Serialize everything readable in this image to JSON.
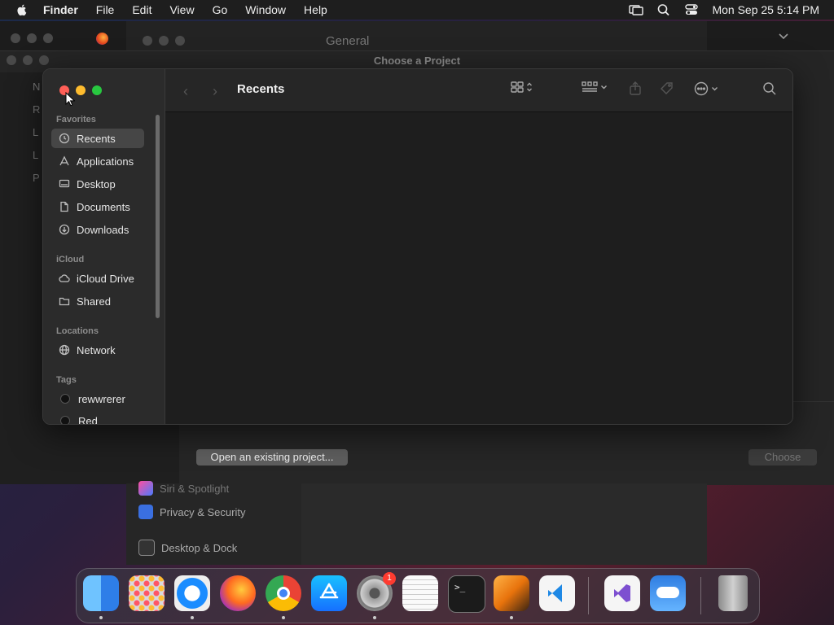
{
  "menubar": {
    "app": "Finder",
    "items": [
      "File",
      "Edit",
      "View",
      "Go",
      "Window",
      "Help"
    ],
    "clock": "Mon Sep 25  5:14 PM"
  },
  "settings_window": {
    "title": "General",
    "list": [
      "Siri & Spotlight",
      "Privacy & Security",
      "Desktop & Dock"
    ]
  },
  "project_window": {
    "title": "Choose a Project",
    "sidebar_fragments": [
      "N",
      "R",
      "L",
      "L",
      "P"
    ],
    "open_button": "Open an existing project...",
    "choose_button": "Choose"
  },
  "finder": {
    "title": "Recents",
    "sections": {
      "favorites": "Favorites",
      "icloud": "iCloud",
      "locations": "Locations",
      "tags": "Tags"
    },
    "favorites": [
      {
        "label": "Recents",
        "icon": "clock-icon",
        "selected": true
      },
      {
        "label": "Applications",
        "icon": "applications-icon"
      },
      {
        "label": "Desktop",
        "icon": "desktop-icon"
      },
      {
        "label": "Documents",
        "icon": "document-icon"
      },
      {
        "label": "Downloads",
        "icon": "download-icon"
      }
    ],
    "icloud": [
      {
        "label": "iCloud Drive",
        "icon": "cloud-icon"
      },
      {
        "label": "Shared",
        "icon": "shared-folder-icon"
      }
    ],
    "locations": [
      {
        "label": "Network",
        "icon": "globe-icon"
      }
    ],
    "tags": [
      {
        "label": "rewwrerer",
        "color": "#111111"
      },
      {
        "label": "Red",
        "color": "#111111"
      }
    ]
  },
  "dock": {
    "apps": [
      "finder-icon",
      "launchpad-icon",
      "safari-icon",
      "firefox-icon",
      "chrome-icon",
      "app-store-icon",
      "system-settings-icon",
      "textedit-icon",
      "terminal-icon",
      "garageband-icon",
      "vscode-icon",
      "visual-studio-icon",
      "weather-icon",
      "trash-icon"
    ],
    "settings_badge": "1"
  }
}
